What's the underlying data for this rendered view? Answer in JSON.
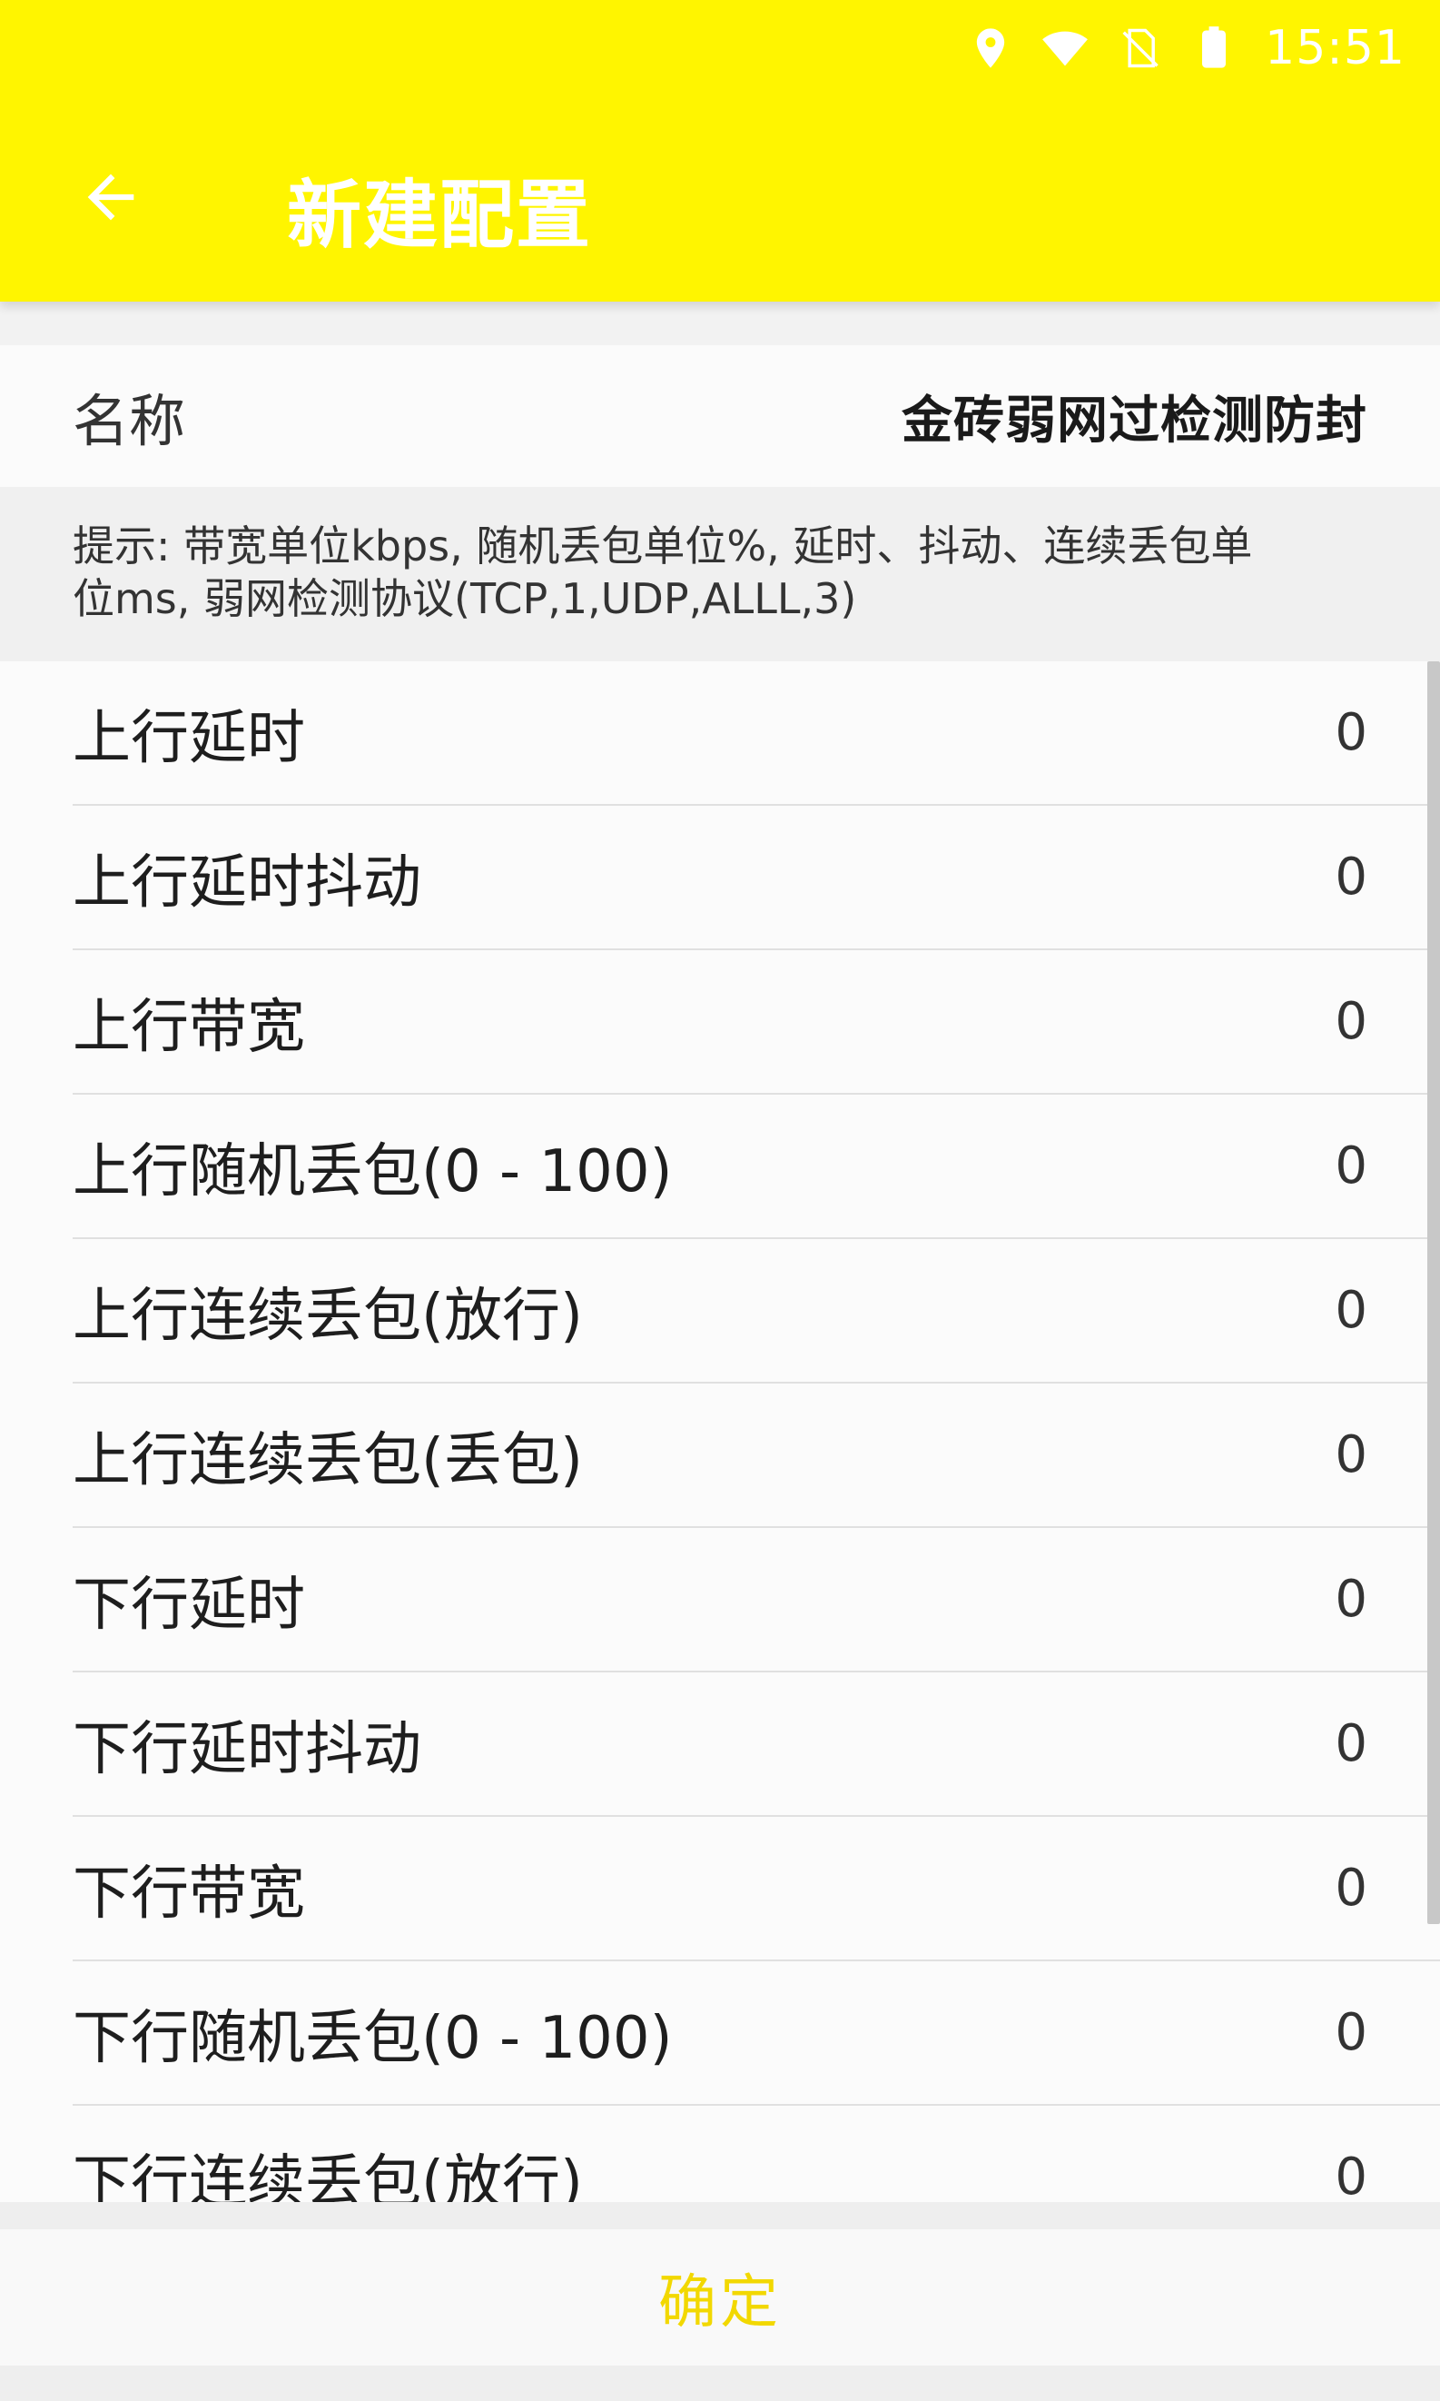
{
  "status_bar": {
    "time": "15:51",
    "icons": [
      "location-icon",
      "wifi-icon",
      "no-sim-icon",
      "battery-icon"
    ]
  },
  "toolbar": {
    "title": "新建配置",
    "back_icon": "arrow-left-icon"
  },
  "name": {
    "label": "名称",
    "value": "金砖弱网过检测防封"
  },
  "hint": {
    "line1": "提示: 带宽单位kbps, 随机丢包单位%, 延时、抖动、连续丢包单",
    "line2": "位ms, 弱网检测协议(TCP,1,UDP,ALLL,3)"
  },
  "settings": [
    {
      "label": "上行延时",
      "value": "0"
    },
    {
      "label": "上行延时抖动",
      "value": "0"
    },
    {
      "label": "上行带宽",
      "value": "0"
    },
    {
      "label": "上行随机丢包(0 - 100)",
      "value": "0"
    },
    {
      "label": "上行连续丢包(放行)",
      "value": "0"
    },
    {
      "label": "上行连续丢包(丢包)",
      "value": "0"
    },
    {
      "label": "下行延时",
      "value": "0"
    },
    {
      "label": "下行延时抖动",
      "value": "0"
    },
    {
      "label": "下行带宽",
      "value": "0"
    },
    {
      "label": "下行随机丢包(0 - 100)",
      "value": "0"
    },
    {
      "label": "下行连续丢包(放行)",
      "value": "0"
    }
  ],
  "confirm": {
    "label": "确定"
  },
  "colors": {
    "accent": "#fff500",
    "confirm_text": "#f2d800"
  }
}
